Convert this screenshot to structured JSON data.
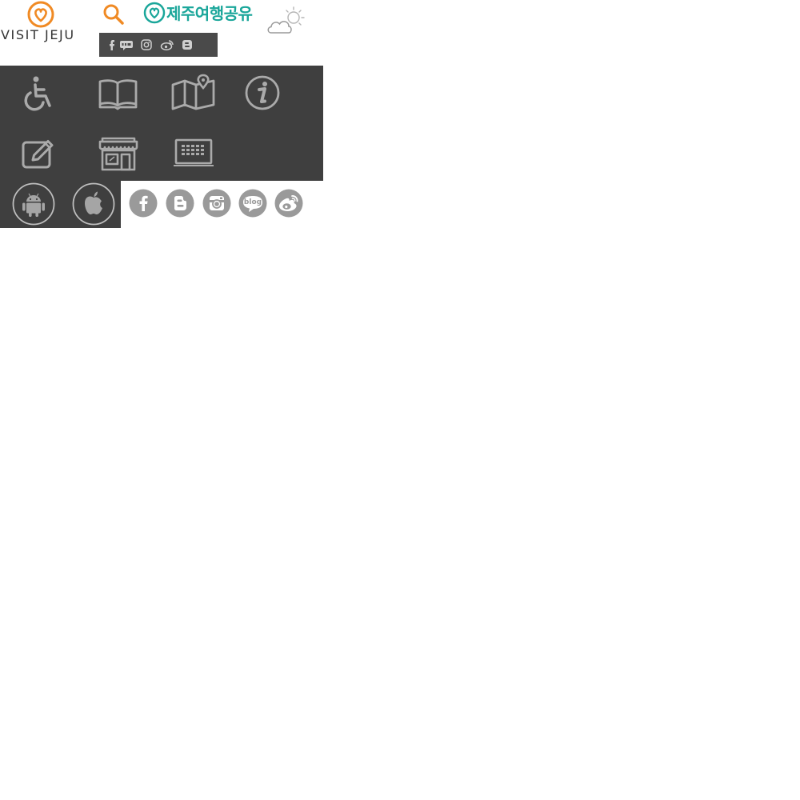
{
  "header": {
    "logo_text": "VISIT JEJU",
    "search_label": "search",
    "share_label": "제주여행공유",
    "weather_label": "partly cloudy"
  },
  "social_strip": {
    "items": [
      {
        "name": "facebook",
        "icon": "facebook-icon"
      },
      {
        "name": "talk",
        "icon": "talk-icon"
      },
      {
        "name": "instagram",
        "icon": "instagram-icon"
      },
      {
        "name": "weibo",
        "icon": "weibo-icon"
      },
      {
        "name": "blogger",
        "icon": "blogger-icon"
      }
    ]
  },
  "menu": {
    "items": [
      {
        "id": "accessible",
        "icon": "wheelchair-icon"
      },
      {
        "id": "guide",
        "icon": "book-icon"
      },
      {
        "id": "map",
        "icon": "map-icon"
      },
      {
        "id": "info",
        "icon": "info-icon"
      },
      {
        "id": "review",
        "icon": "edit-icon"
      },
      {
        "id": "shop",
        "icon": "store-icon"
      },
      {
        "id": "keyboard",
        "icon": "laptop-icon"
      }
    ]
  },
  "apps": [
    {
      "platform": "android",
      "icon": "android-icon"
    },
    {
      "platform": "ios",
      "icon": "apple-icon"
    }
  ],
  "sns": [
    {
      "name": "facebook",
      "icon": "facebook-icon",
      "label": "f"
    },
    {
      "name": "blogger",
      "icon": "blogger-icon",
      "label": "B"
    },
    {
      "name": "instagram",
      "icon": "instagram-icon",
      "label": ""
    },
    {
      "name": "blog",
      "icon": "blog-icon",
      "label": "blog"
    },
    {
      "name": "weibo",
      "icon": "weibo-icon",
      "label": ""
    }
  ],
  "colors": {
    "brand_orange": "#f08a24",
    "share_teal": "#1aa69a",
    "panel_dark": "#3f3f3f",
    "icon_gray": "#aaaaaa",
    "sns_gray": "#9a9a9a"
  }
}
